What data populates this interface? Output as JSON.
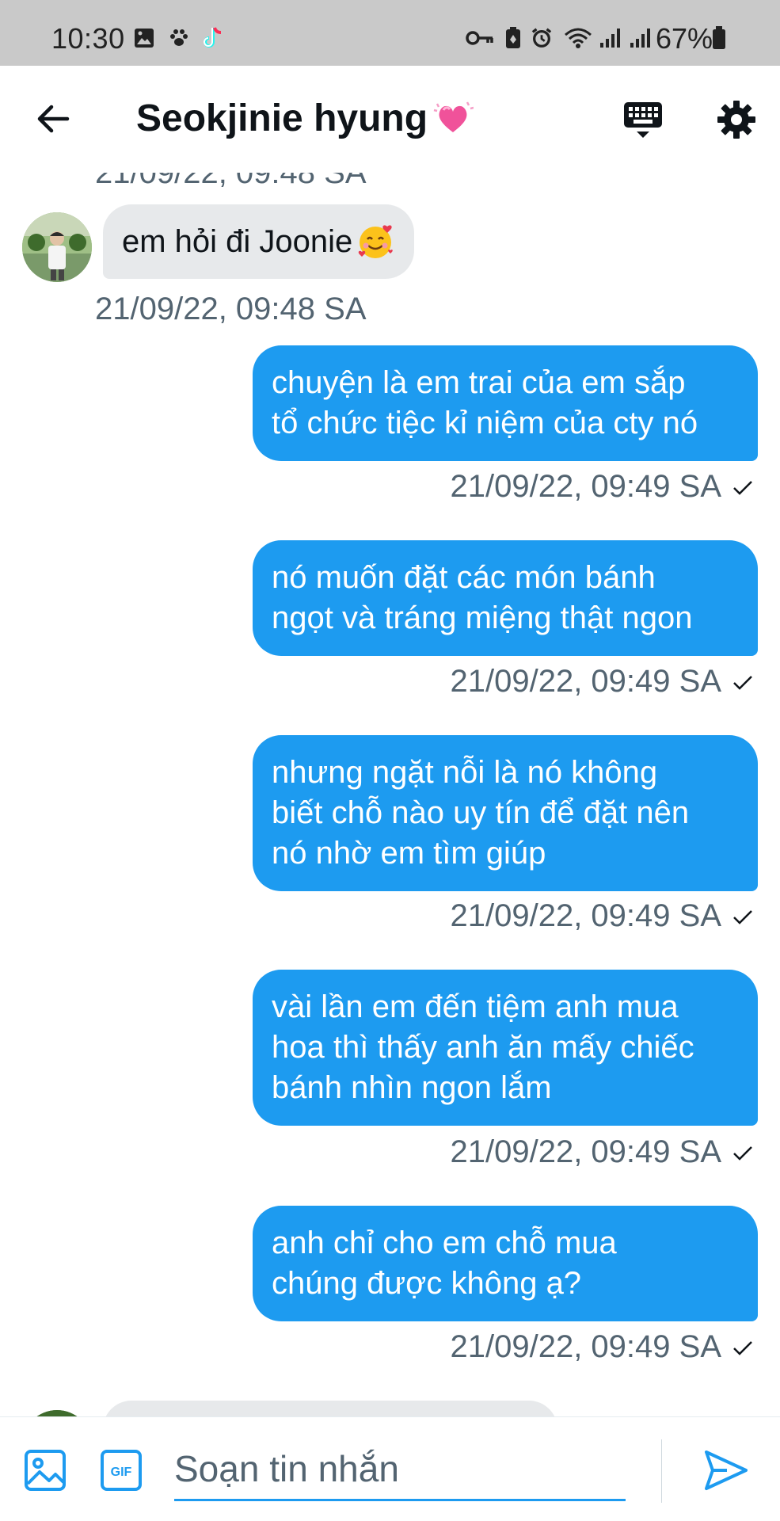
{
  "status_bar": {
    "time": "10:30",
    "battery": "67%",
    "icons_left": [
      "gallery-icon",
      "paw-icon",
      "tiktok-icon"
    ],
    "icons_right": [
      "vpn-key-icon",
      "battery-saver-icon",
      "alarm-icon",
      "wifi-icon",
      "signal-icon",
      "signal-icon-2",
      "battery-icon"
    ]
  },
  "header": {
    "title": "Seokjinie hyung",
    "title_emoji": "sparkling-heart-emoji",
    "back_icon": "arrow-left-icon",
    "keyboard_icon": "keyboard-icon",
    "settings_icon": "gear-icon"
  },
  "messages": {
    "top_partial_timestamp": "21/09/22, 09:48 SA",
    "items": [
      {
        "direction": "incoming",
        "text": "em hỏi đi Joonie",
        "emoji": "smiling-face-with-hearts-emoji",
        "timestamp": "21/09/22, 09:48 SA"
      },
      {
        "direction": "outgoing",
        "lines": [
          "chuyện là em trai của em sắp",
          "tổ chức tiệc kỉ niệm của cty nó"
        ],
        "timestamp": "21/09/22, 09:49 SA"
      },
      {
        "direction": "outgoing",
        "lines": [
          "nó muốn đặt các món bánh",
          "ngọt và tráng miệng thật ngon"
        ],
        "timestamp": "21/09/22, 09:49 SA"
      },
      {
        "direction": "outgoing",
        "lines": [
          "nhưng ngặt nỗi là nó không",
          "biết chỗ nào uy tín để đặt nên",
          "nó nhờ em tìm giúp"
        ],
        "timestamp": "21/09/22, 09:49 SA"
      },
      {
        "direction": "outgoing",
        "lines": [
          "vài lần em đến tiệm anh mua",
          "hoa thì thấy anh ăn mấy chiếc",
          "bánh nhìn ngon lắm"
        ],
        "timestamp": "21/09/22, 09:49 SA"
      },
      {
        "direction": "outgoing",
        "lines": [
          "anh chỉ cho em chỗ mua",
          "chúng được không ạ?"
        ],
        "timestamp": "21/09/22, 09:49 SA"
      }
    ]
  },
  "compose": {
    "placeholder": "Soạn tin nhắn",
    "gif_label": "GIF",
    "image_icon": "image-icon",
    "send_icon": "send-icon"
  },
  "colors": {
    "accent": "#1d9bf0",
    "incoming_bubble": "#e7e9eb",
    "timestamp": "#536471",
    "status_bar": "#c9c9c9"
  }
}
